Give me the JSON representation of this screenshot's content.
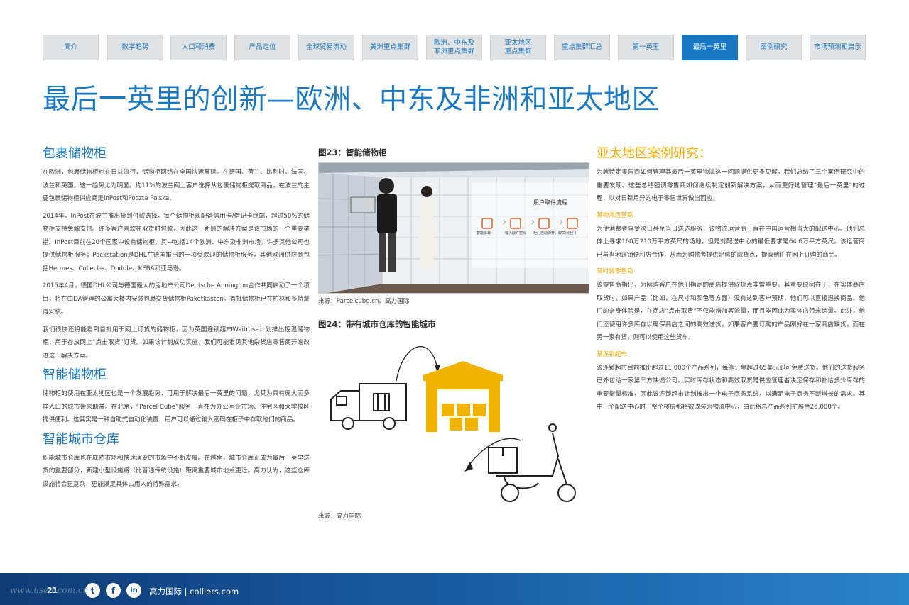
{
  "nav": {
    "tabs": [
      {
        "label": "简介",
        "active": false
      },
      {
        "label": "数字趋势",
        "active": false
      },
      {
        "label": "人口和消费",
        "active": false
      },
      {
        "label": "产品定位",
        "active": false
      },
      {
        "label": "全球贸易流动",
        "active": false
      },
      {
        "label": "美洲重点集群",
        "active": false
      },
      {
        "label": "欧洲、中东及\n非洲重点集群",
        "active": false
      },
      {
        "label": "亚太地区\n重点集群",
        "active": false
      },
      {
        "label": "重点集群汇总",
        "active": false
      },
      {
        "label": "第一英里",
        "active": false
      },
      {
        "label": "最后一英里",
        "active": true
      },
      {
        "label": "案例研究",
        "active": false
      },
      {
        "label": "市场预测和启示",
        "active": false
      }
    ]
  },
  "title": "最后一英里的创新—欧洲、中东及非洲和亚太地区",
  "col1": {
    "h1": "包裹储物柜",
    "p1": "在欧洲，包裹储物柜也在日益流行，储物柜网络在全国快速蔓延。在德国、荷兰、比利时、法国、波兰和英国，这一趋势尤为明显。约11%的波兰网上客户选择从包裹储物柜提取商品，在波兰的主要包裹储物柜供应商是InPost和Poczta Polska。",
    "p2": "2014年，InPost在波兰推出货到付款选择，每个储物柜现配备信用卡/借记卡终端，超过50%的储物柜支持免触支付。许多客户喜欢在取货时付款，因此这一新颖的解决方案是该市场的一个重要举措。InPost目前在20个国家中设有储物柜，其中包括14个欧洲、中东及非洲市场。许多其他公司也提供储物柜服务；Packstation是DHL在德国推出的一项受欢迎的储物柜服务，其他欧洲供应商包括Hermes、Collect+、Doddle、KEBA和亚马逊。",
    "p3": "2015年4月，德国DHL公司与德国最大的房地产公司Deutsche Annington合作共同启动了一个项目，将在由DA管理的公寓大楼内安装包裹交货储物柜Paketkästen。首批储物柜已在柏林和多特蒙得安装。",
    "p4": "我们很快还将能看到首批用于网上订货的储物柜，因为英国连锁超市Waitrose计划推出控温储物柜，用于存放网上“点击取货”订货。如果该计划成功实施，我们可能看见其他杂货店零售商开始改进这一解决方案。",
    "h2": "智能储物柜",
    "p5": "储物柜的使用在亚太地区也是一个发展趋势，可用于解决最后一英里的问题，尤其为具有庞大而多样人口的城市带来助益。在北京，“Parcel Cube”服务一直在为办公室亚市场、住宅区和大学校区提供便利。这其实是一种自助式自动化装置，用户可以通过输入密码在柜子中存取他们的商品。",
    "h3": "智能城市仓库",
    "p6": "职能城市仓库也在成熟市场和快速演变的市场中不断发展。在越南，城市仓库正成为最后一英里送货的重要部分，新建小型设施将（比普通传统设施）距离重要城市地点更近。高力认为，这些仓库设施将会更复杂，更能满足具体占用人的特殊需求。"
  },
  "col2": {
    "fig23_title": "图23：智能储物柜",
    "fig23_overlay": "用户取件流程",
    "fig23_steps": [
      "智能屏幕",
      "输入取件密码",
      "柜门自动弹开，取件",
      "关闭柜门"
    ],
    "fig23_source": "来源：Parcelcube.cn、高力国际",
    "fig24_title": "图24：带有城市仓库的智能城市",
    "fig24_source": "来源：高力国际"
  },
  "col3": {
    "h1": "亚太地区案例研究：",
    "intro": "为就特定零售商如何管理其最后一英里物流这一问题提供更多见解，我们总结了三个案例研究中的重要发现。这些总结强调零售商如何继续制定创新解决方案，从而更好地管理“最后一英里”的过程，以对日新月异的电子零售世界做出回应。",
    "s1": "某物流运营商",
    "t1": "为使消费者享受次日甚至当日送达服务，该物流运营商一直在中国运营相当大的配送中心。他们总体上寻求160万210万平方英尺的场地，但是对配送中心的最低要求是64.6万平方英尺。该运营商已与当地连锁便利店合作，从而为购物者提供足够的取货点，提取他们在网上订购的商品。",
    "s2": "某时装零售商",
    "t2": "该零售商指出，为网购客户在他们指定的商店提供取货点非常重要。其重要原因在于，在实体商店取货时，如果产品（比如，在尺寸和颜色等方面）没有达到客户预期，他们可以直接退换商品。他们的亲身体验是，在商店“点击取货”不仅能增加客流量，而且能因此为实体店带来销量。此外，他们还使用许多库存以确保商店之间的高效送货，如果客户要订购的产品刚好在一家商店缺货，而在另一家有货，则可以使用这些货车。",
    "s3": "某连锁超市",
    "t3": "该连锁超市目前推出超过11,000个产品系列，每笔订单超过65美元即可免费送货。他们的送货服务已外包给一家第三方快递公司。实时库存状态和高效取货是供应管理者决定保存和补给多少库存的重要衡量标准，因此该连锁超市计划推出一个电子商务系统，以满足电子商务不断增长的需求。其中一个配送中心的一整个楼层都将被改装为物流中心，由此将总产品系列扩展至25,000个。"
  },
  "footer": {
    "page": "21",
    "brand": "高力国际 | colliers.com",
    "social": [
      "twitter-icon",
      "facebook-icon",
      "linkedin-icon"
    ]
  },
  "watermark": "www.useit.com.cn",
  "colors": {
    "accent": "#1a78c2",
    "gold": "#f2a900",
    "tab_bg": "#dfe3e6",
    "footer": "#134b8a"
  }
}
